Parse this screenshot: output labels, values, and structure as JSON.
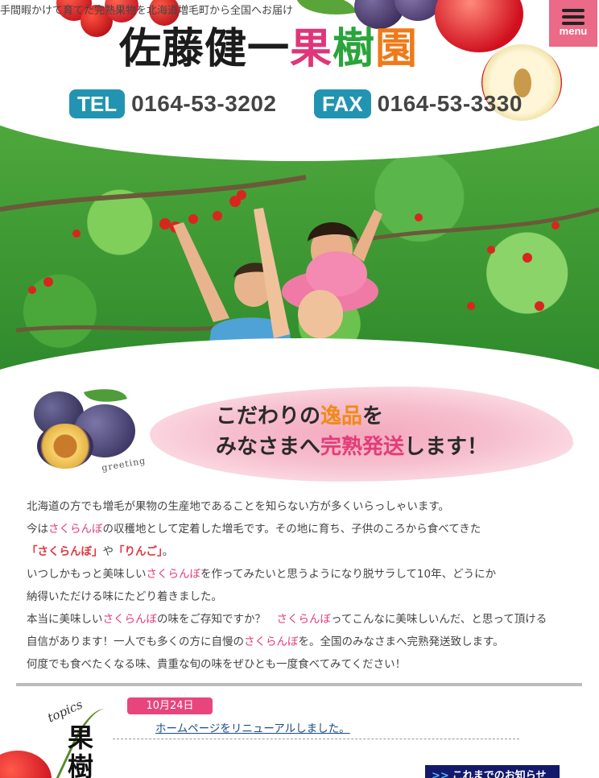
{
  "header": {
    "tagline": "手間暇かけて育てた完熟果物を北海道増毛町から全国へお届け",
    "title_name": "佐藤健一",
    "title_ka": "果",
    "title_ju": "樹",
    "title_en": "園",
    "tel_label": "TEL",
    "tel_number": "0164-53-3202",
    "fax_label": "FAX",
    "fax_number": "0164-53-3330",
    "menu_label": "menu"
  },
  "greeting": {
    "script_label": "greeting",
    "line1_a": "こだわりの",
    "line1_b": "逸品",
    "line1_c": "を",
    "line2_a": "みなさまへ",
    "line2_b": "完熟発送",
    "line2_c": "します！"
  },
  "intro": {
    "p1": "北海道の方でも増毛が果物の生産地であることを知らない方が多くいらっしゃいます。",
    "p2_a": "今は",
    "p2_b": "さくらんぼ",
    "p2_c": "の収穫地として定着した増毛です。その地に育ち、子供のころから食べてきた",
    "p3_a": "「さくらんぼ」",
    "p3_b": "や",
    "p3_c": "「りんご」",
    "p3_d": "。",
    "p4_a": "いつしかもっと美味しい",
    "p4_b": "さくらんぼ",
    "p4_c": "を作ってみたいと思うようになり脱サラして10年、どうにか",
    "p5": "納得いただける味にたどり着きました。",
    "p6_a": "本当に美味しい",
    "p6_b": "さくらんぼ",
    "p6_c": "の味をご存知ですか？　",
    "p6_d": "さくらんぼ",
    "p6_e": "ってこんなに美味しいんだ、と思って頂ける",
    "p7_a": "自信があります！一人でも多くの方に自慢の",
    "p7_b": "さくらんぼ",
    "p7_c": "を。全国のみなさまへ完熟発送致します。",
    "p8": "何度でも食べたくなる味、貴重な旬の味をぜひとも一度食べてみてください！"
  },
  "topics": {
    "script_label": "topics",
    "kanji_line1": "果",
    "kanji_line2": "樹",
    "news": [
      {
        "date": "10月24日",
        "title": "ホームページをリニューアルしました。"
      }
    ],
    "more_arrow": ">>",
    "more_label": "これまでのお知らせ"
  },
  "colors": {
    "menu_bg": "#ea6a87",
    "tel_badge": "#2294b2",
    "accent_pink": "#e5397c",
    "date_badge": "#e8457c",
    "more_button": "#14196b"
  }
}
